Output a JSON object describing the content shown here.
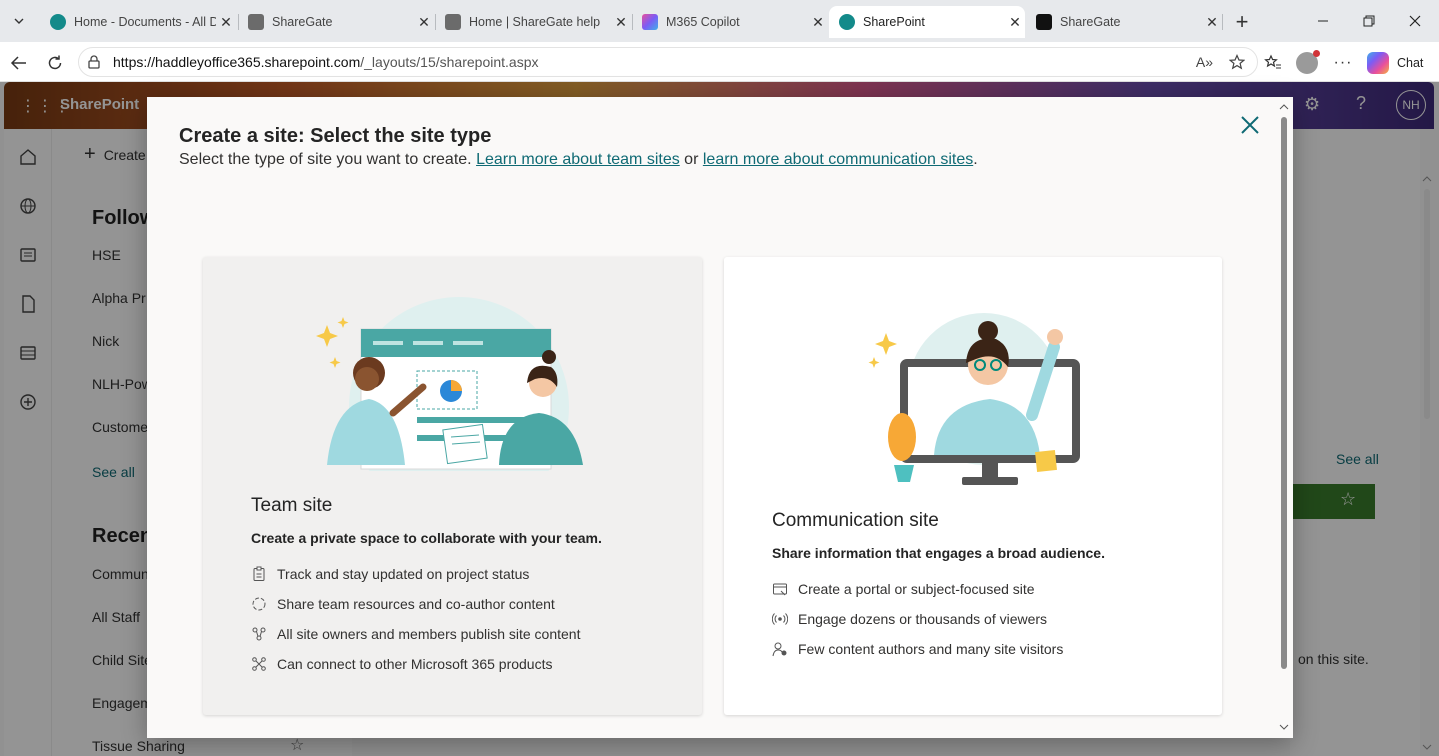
{
  "browser": {
    "tabs": [
      {
        "label": "Home - Documents - All D",
        "active": false
      },
      {
        "label": "ShareGate",
        "active": false
      },
      {
        "label": "Home | ShareGate help",
        "active": false
      },
      {
        "label": "M365 Copilot",
        "active": false
      },
      {
        "label": "SharePoint",
        "active": true
      },
      {
        "label": "ShareGate",
        "active": false
      }
    ],
    "url_host": "https://haddleyoffice365.sharepoint.com",
    "url_path": "/_layouts/15/sharepoint.aspx",
    "chat_label": "Chat"
  },
  "sharepoint": {
    "brand": "SharePoint",
    "create_label": "Create",
    "user_initials": "NH",
    "following_heading": "Follow",
    "following_items": [
      "HSE",
      "Alpha Pr",
      "Nick",
      "NLH-Pow",
      "Custome"
    ],
    "see_all_left": "See all",
    "recent_heading": "Recen",
    "recent_items": [
      "Commun",
      "All Staff",
      "Child Site",
      "Engagem",
      "Tissue Sharing"
    ],
    "see_all_right": "See all",
    "right_snippet": "on this site."
  },
  "dialog": {
    "title": "Create a site: Select the site type",
    "subtitle_prefix": "Select the type of site you want to create. ",
    "link_team": "Learn more about team sites",
    "subtitle_or": " or ",
    "link_comm": "learn more about communication sites",
    "subtitle_end": ".",
    "team": {
      "title": "Team site",
      "description": "Create a private space to collaborate with your team.",
      "features": [
        {
          "icon": "clipboard-icon",
          "text": "Track and stay updated on project status"
        },
        {
          "icon": "sync-circle-icon",
          "text": "Share team resources and co-author content"
        },
        {
          "icon": "people-network-icon",
          "text": "All site owners and members publish site content"
        },
        {
          "icon": "connect-icon",
          "text": "Can connect to other Microsoft 365 products"
        }
      ]
    },
    "communication": {
      "title": "Communication site",
      "description": "Share information that engages a broad audience.",
      "features": [
        {
          "icon": "portal-icon",
          "text": "Create a portal or subject-focused site"
        },
        {
          "icon": "broadcast-icon",
          "text": "Engage dozens or thousands of viewers"
        },
        {
          "icon": "person-view-icon",
          "text": "Few content authors and many site visitors"
        }
      ]
    }
  },
  "colors": {
    "accent": "#0f6a74",
    "team_card_bg": "#f1f0ef",
    "illustration_teal": "#4aa7a4"
  }
}
